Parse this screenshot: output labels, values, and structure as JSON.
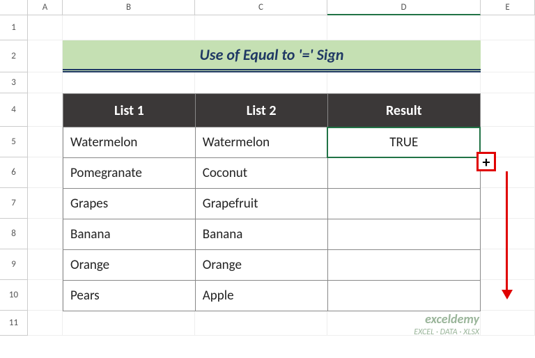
{
  "columns": {
    "A": "A",
    "B": "B",
    "C": "C",
    "D": "D",
    "E": "E"
  },
  "rows": [
    "1",
    "2",
    "3",
    "4",
    "5",
    "6",
    "7",
    "8",
    "9",
    "10",
    "11"
  ],
  "title": "Use of Equal to '=' Sign",
  "headers": {
    "b": "List 1",
    "c": "List 2",
    "d": "Result"
  },
  "data": [
    {
      "b": "Watermelon",
      "c": "Watermelon",
      "d": "TRUE"
    },
    {
      "b": "Pomegranate",
      "c": "Coconut",
      "d": ""
    },
    {
      "b": "Grapes",
      "c": "Grapefruit",
      "d": ""
    },
    {
      "b": "Banana",
      "c": "Banana",
      "d": ""
    },
    {
      "b": "Orange",
      "c": "Orange",
      "d": ""
    },
    {
      "b": "Pears",
      "c": "Apple",
      "d": ""
    }
  ],
  "fill_cursor": "+",
  "watermark": {
    "brand": "exceldemy",
    "tag": "EXCEL · DATA · XLSX"
  },
  "chart_data": {
    "type": "table",
    "title": "Use of Equal to '=' Sign",
    "columns": [
      "List 1",
      "List 2",
      "Result"
    ],
    "rows": [
      [
        "Watermelon",
        "Watermelon",
        "TRUE"
      ],
      [
        "Pomegranate",
        "Coconut",
        ""
      ],
      [
        "Grapes",
        "Grapefruit",
        ""
      ],
      [
        "Banana",
        "Banana",
        ""
      ],
      [
        "Orange",
        "Orange",
        ""
      ],
      [
        "Pears",
        "Apple",
        ""
      ]
    ]
  }
}
